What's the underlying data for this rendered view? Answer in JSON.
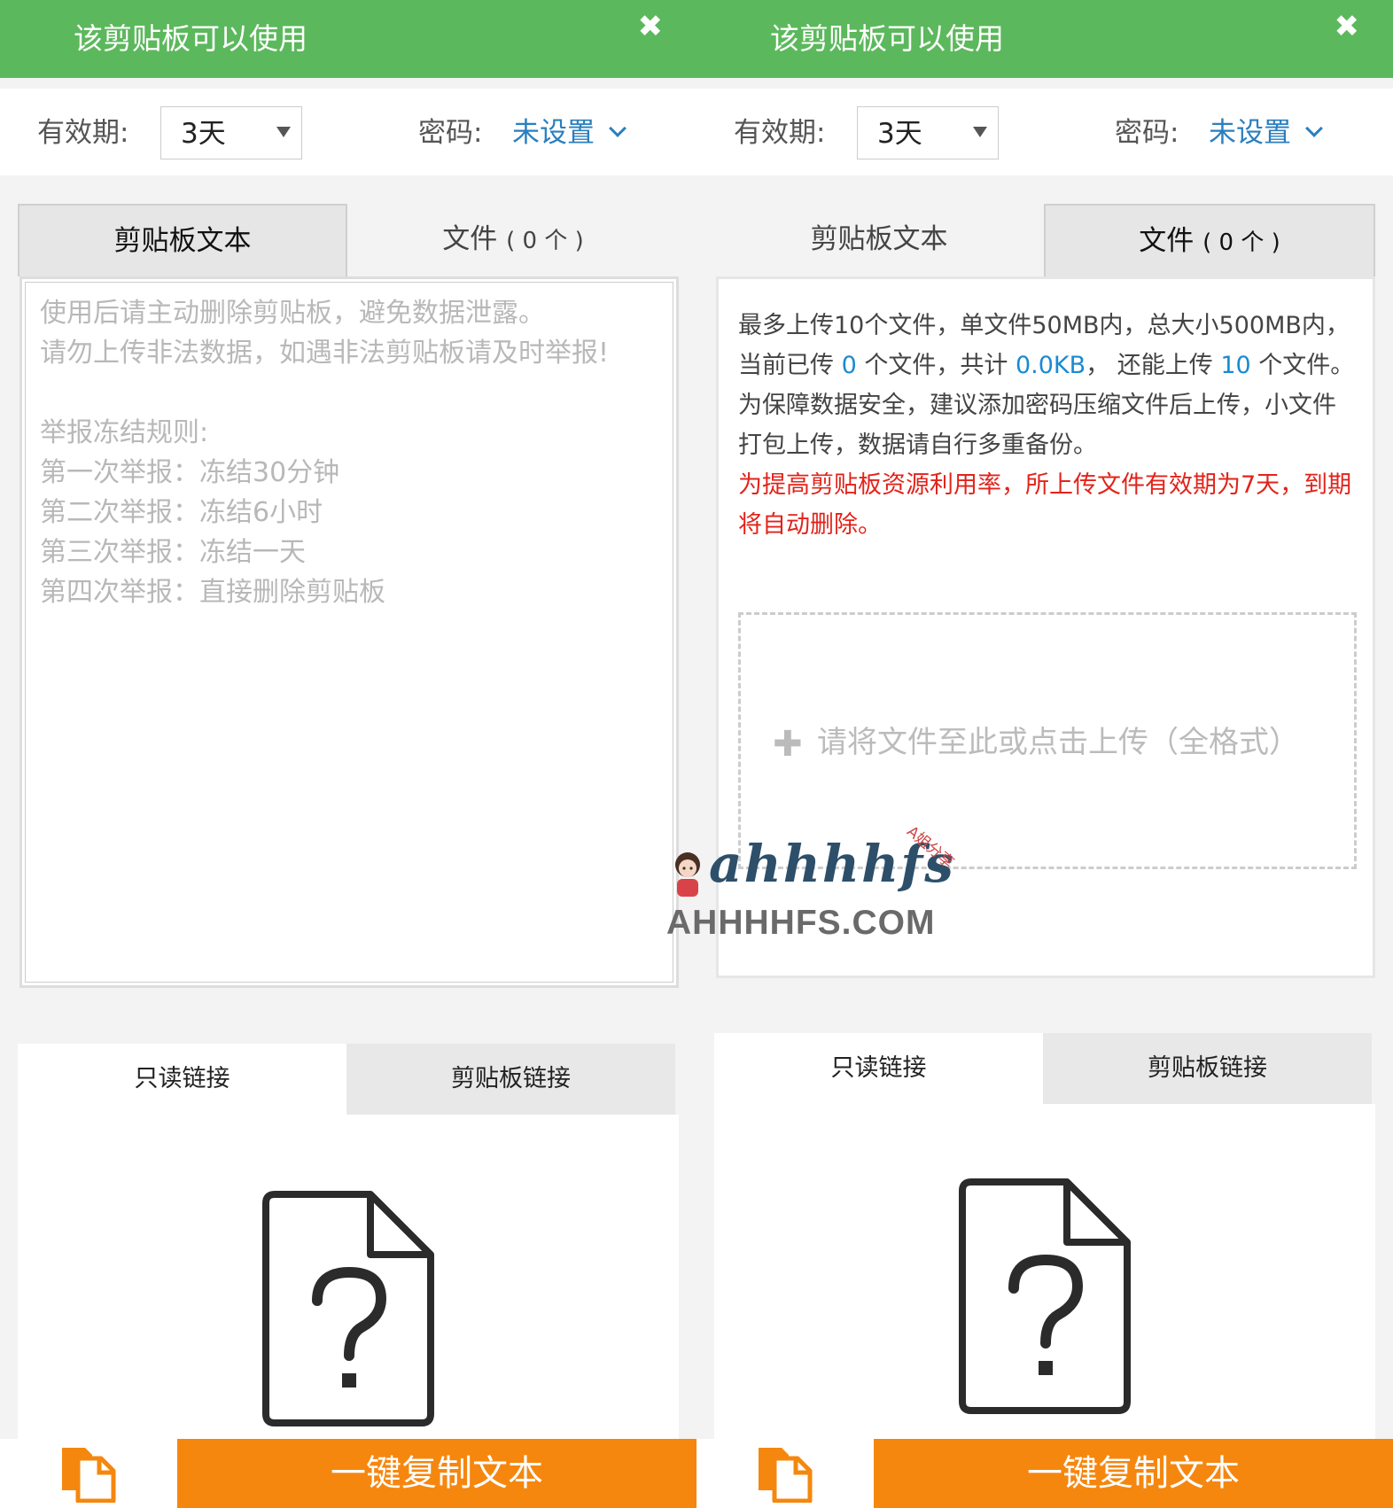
{
  "panels": [
    {
      "banner": "该剪贴板可以使用",
      "expire_label": "有效期:",
      "expire_value": "3天",
      "password_label": "密码:",
      "password_value": "未设置",
      "tab_text": "剪贴板文本",
      "tab_files": "文件",
      "tab_files_count": "( 0 个 )",
      "active_tab": "text",
      "placeholder": "使用后请主动删除剪贴板，避免数据泄露。\n请勿上传非法数据，如遇非法剪贴板请及时举报!\n\n举报冻结规则:\n第一次举报：冻结30分钟\n第二次举报：冻结6小时\n第三次举报：冻结一天\n第四次举报：直接删除剪贴板",
      "link_readonly": "只读链接",
      "link_clipboard": "剪贴板链接",
      "copy_button": "一键复制文本"
    },
    {
      "banner": "该剪贴板可以使用",
      "expire_label": "有效期:",
      "expire_value": "3天",
      "password_label": "密码:",
      "password_value": "未设置",
      "tab_text": "剪贴板文本",
      "tab_files": "文件",
      "tab_files_count": "( 0 个 )",
      "active_tab": "files",
      "info": {
        "line1": "最多上传10个文件，单文件50MB内，总大小500MB内，",
        "current_prefix": "当前已传",
        "current_count": "0",
        "files_total_prefix": "个文件，共计",
        "total_size": "0.0KB",
        "remain_prefix": "，  还能上传",
        "remain_count": "10",
        "remain_suffix": "个文件。",
        "tip": "为保障数据安全，建议添加密码压缩文件后上传，小文件打包上传，数据请自行多重备份。",
        "warning": "为提高剪贴板资源利用率，所上传文件有效期为7天，到期将自动删除。"
      },
      "drop_text": "请将文件至此或点击上传（全格式）",
      "link_readonly": "只读链接",
      "link_clipboard": "剪贴板链接",
      "copy_button": "一键复制文本"
    }
  ],
  "watermark": {
    "logo": "ahhhhfs",
    "tag": "A姐分享",
    "site": "AHHHHFS.COM"
  },
  "colors": {
    "banner": "#5cb85c",
    "accent_link": "#2a7fbf",
    "highlight": "#1a8ad2",
    "warning": "#e2231a",
    "copy_button": "#f5870f"
  }
}
